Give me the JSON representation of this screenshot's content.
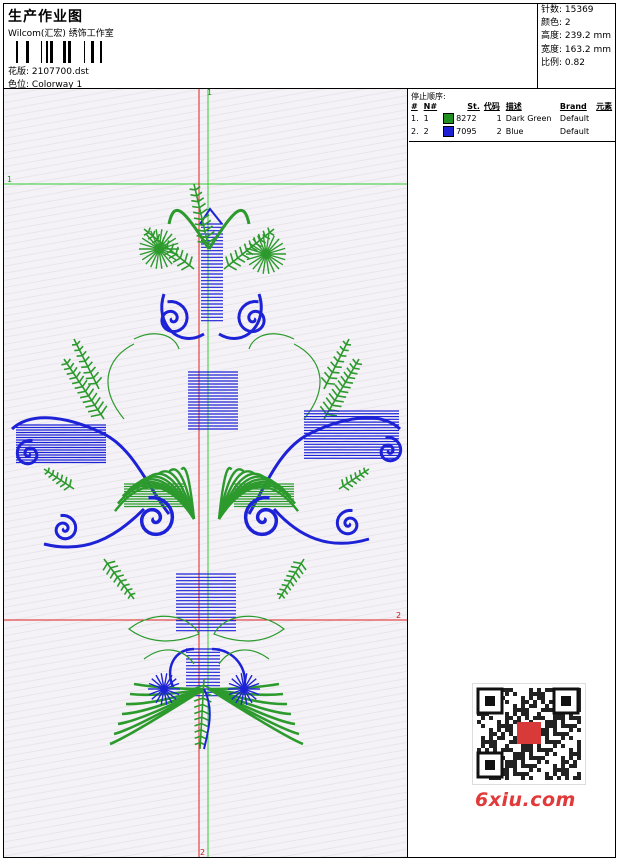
{
  "header": {
    "title": "生产作业图",
    "company": "Wilcom(汇宏) 绣饰工作室",
    "design_label": "花版:",
    "design_value": "2107700.dst",
    "colorway_label": "色位:",
    "colorway_value": "Colorway 1"
  },
  "stats": {
    "stitches": "针数: 15369",
    "colors": "颜色: 2",
    "height": "高度: 239.2 mm",
    "width": "宽度: 163.2 mm",
    "scale": "比例: 0.82"
  },
  "stop_sequence": {
    "title": "停止顺序:",
    "columns": [
      "#",
      "N#",
      "St.",
      "代码",
      "描述",
      "Brand",
      "元素"
    ],
    "rows": [
      {
        "index": "1.",
        "n": "1",
        "swatch": "#1f8f1f",
        "code": "8272",
        "st": "1",
        "desc": "Dark Green",
        "brand": "Default"
      },
      {
        "index": "2.",
        "n": "2",
        "swatch": "#1f1fd6",
        "code": "7095",
        "st": "2",
        "desc": "Blue",
        "brand": "Default"
      }
    ]
  },
  "guides": {
    "green_v_label": "1",
    "green_h_label": "1",
    "red_h_label": "2",
    "red_v_label": "2"
  },
  "colors": {
    "green": "#2c9a2c",
    "blue": "#1e22d6",
    "guide_green": "#33cc33",
    "guide_red": "#e02020",
    "watermark": "#e03a3a"
  },
  "watermark": {
    "text": "6xiu.com"
  }
}
